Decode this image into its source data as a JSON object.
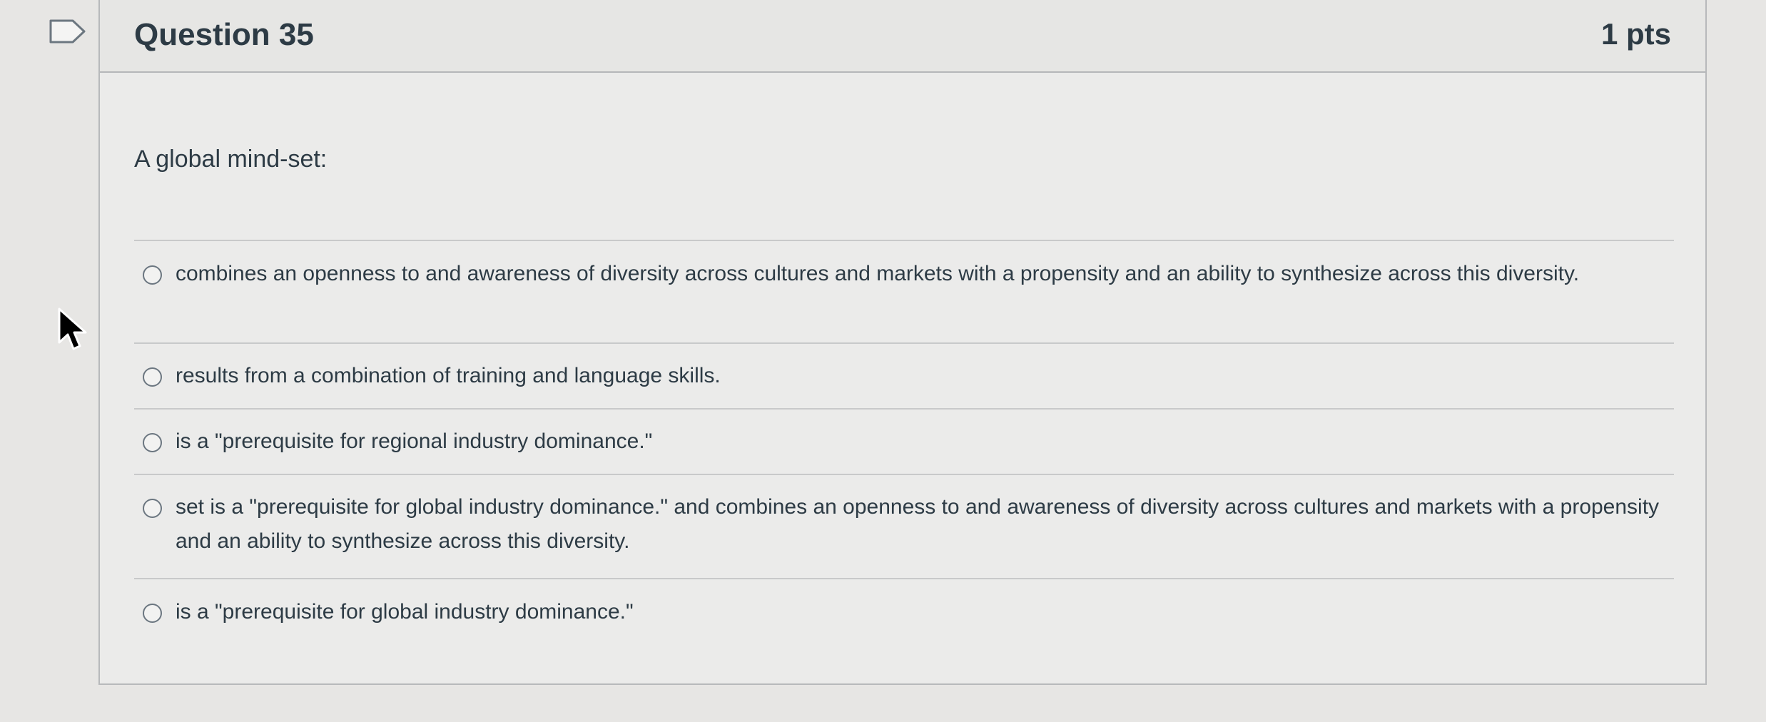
{
  "icons": {
    "flag": "flag-question-icon",
    "cursor": "arrow-cursor-icon"
  },
  "question": {
    "title": "Question 35",
    "points": "1 pts",
    "text": "A global mind-set:"
  },
  "answers": [
    {
      "label": "combines an openness to and awareness of diversity across cultures and markets with a propensity and an ability to synthesize across this diversity.",
      "selected": false
    },
    {
      "label": "results from a combination of training and language skills.",
      "selected": false
    },
    {
      "label": "is a \"prerequisite for regional industry dominance.\"",
      "selected": false
    },
    {
      "label": "set is a \"prerequisite for global industry dominance.\" and combines an openness to and awareness of diversity across cultures and markets with a propensity and an ability to synthesize across this diversity.",
      "selected": false
    },
    {
      "label": "is a \"prerequisite for global industry dominance.\"",
      "selected": false
    }
  ]
}
